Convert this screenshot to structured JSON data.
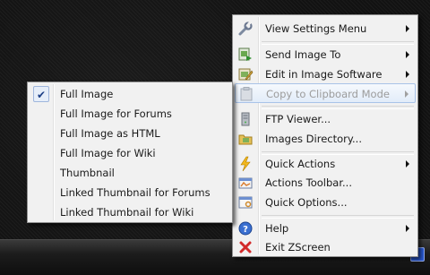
{
  "main_menu": {
    "items": [
      {
        "label": "View Settings Menu",
        "icon": "wrench-icon",
        "submenu": true
      },
      {
        "label": "Send Image To",
        "icon": "send-image-icon",
        "submenu": true
      },
      {
        "label": "Edit in Image Software",
        "icon": "edit-image-icon",
        "submenu": true
      },
      {
        "label": "Copy to Clipboard Mode",
        "icon": "clipboard-icon",
        "submenu": true,
        "disabled": true
      },
      {
        "label": "FTP Viewer...",
        "icon": "ftp-server-icon"
      },
      {
        "label": "Images Directory...",
        "icon": "folder-icon"
      },
      {
        "label": "Quick Actions",
        "icon": "lightning-icon",
        "submenu": true
      },
      {
        "label": "Actions Toolbar...",
        "icon": "toolbar-icon"
      },
      {
        "label": "Quick Options...",
        "icon": "options-icon"
      },
      {
        "label": "Help",
        "icon": "help-icon",
        "submenu": true
      },
      {
        "label": "Exit ZScreen",
        "icon": "exit-x-icon"
      }
    ]
  },
  "sub_menu": {
    "items": [
      {
        "label": "Full Image",
        "checked": true
      },
      {
        "label": "Full Image for Forums"
      },
      {
        "label": "Full Image as HTML"
      },
      {
        "label": "Full Image for Wiki"
      },
      {
        "label": "Thumbnail"
      },
      {
        "label": "Linked Thumbnail for Forums"
      },
      {
        "label": "Linked Thumbnail for Wiki"
      }
    ]
  },
  "colors": {
    "menu_background": "#f1f1f1",
    "highlight": "#e2ecf9",
    "disabled_text": "#9c9c9c"
  }
}
